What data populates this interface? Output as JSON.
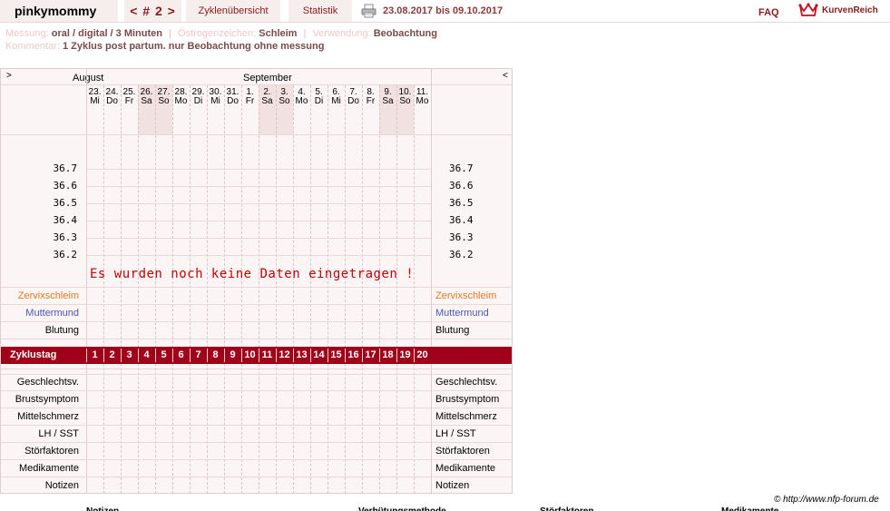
{
  "header": {
    "username": "pinkymommy",
    "cycle_nav": "< # 2 >",
    "tab_overview": "Zyklenübersicht",
    "tab_stats": "Statistik",
    "date_range": "23.08.2017 bis 09.10.2017",
    "faq": "FAQ",
    "logo_text": "KurvenReich"
  },
  "info": {
    "messung_label": "Messung:",
    "messung_value": "oral / digital / 3 Minuten",
    "oestrogen_label": "Östrogenzeichen:",
    "oestrogen_value": "Schleim",
    "verwendung_label": "Verwendung:",
    "verwendung_value": "Beobachtung",
    "kommentar_label": "Kommentar:",
    "kommentar_value": "1 Zyklus post partum. nur Beobachtung ohne messung"
  },
  "chart": {
    "nav_prev": ">",
    "nav_next": "<",
    "month1": "August",
    "month2": "September",
    "days": [
      {
        "date": "23.",
        "wd": "Mi",
        "weekend": false
      },
      {
        "date": "24.",
        "wd": "Do",
        "weekend": false
      },
      {
        "date": "25.",
        "wd": "Fr",
        "weekend": false
      },
      {
        "date": "26.",
        "wd": "Sa",
        "weekend": true
      },
      {
        "date": "27.",
        "wd": "So",
        "weekend": true
      },
      {
        "date": "28.",
        "wd": "Mo",
        "weekend": false
      },
      {
        "date": "29.",
        "wd": "Di",
        "weekend": false
      },
      {
        "date": "30.",
        "wd": "Mi",
        "weekend": false
      },
      {
        "date": "31.",
        "wd": "Do",
        "weekend": false
      },
      {
        "date": "1.",
        "wd": "Fr",
        "weekend": false
      },
      {
        "date": "2.",
        "wd": "Sa",
        "weekend": true
      },
      {
        "date": "3.",
        "wd": "So",
        "weekend": true
      },
      {
        "date": "4.",
        "wd": "Mo",
        "weekend": false
      },
      {
        "date": "5.",
        "wd": "Di",
        "weekend": false
      },
      {
        "date": "6.",
        "wd": "Mi",
        "weekend": false
      },
      {
        "date": "7.",
        "wd": "Do",
        "weekend": false
      },
      {
        "date": "8.",
        "wd": "Fr",
        "weekend": false
      },
      {
        "date": "9.",
        "wd": "Sa",
        "weekend": true
      },
      {
        "date": "10.",
        "wd": "So",
        "weekend": true
      },
      {
        "date": "11.",
        "wd": "Mo",
        "weekend": false
      }
    ],
    "temperatures": [
      "36.7",
      "36.6",
      "36.5",
      "36.4",
      "36.3",
      "36.2"
    ],
    "no_data_message": "Es wurden noch keine Daten eingetragen !",
    "row_cervix": "Zervixschleim",
    "row_muttermund": "Muttermund",
    "row_blutung": "Blutung",
    "cycle_day_label": "Zyklustag",
    "cycle_days": [
      "1",
      "2",
      "3",
      "4",
      "5",
      "6",
      "7",
      "8",
      "9",
      "10",
      "11",
      "12",
      "13",
      "14",
      "15",
      "16",
      "17",
      "18",
      "19",
      "20"
    ],
    "bottom_rows": [
      "Geschlechtsv.",
      "Brustsymptom",
      "Mittelschmerz",
      "LH / SST",
      "Störfaktoren",
      "Medikamente",
      "Notizen"
    ]
  },
  "footer": {
    "copyright": "© http://www.nfp-forum.de",
    "col_labels": [
      "Notizen",
      "Verhütungsmethode",
      "Störfaktoren",
      "Medikamente"
    ]
  }
}
